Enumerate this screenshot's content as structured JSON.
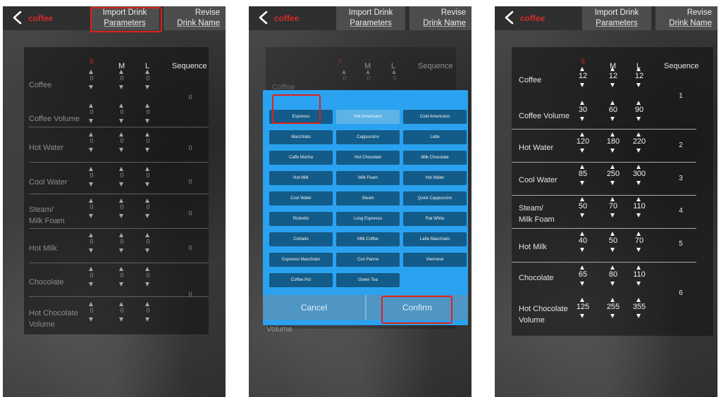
{
  "app_title": "coffee",
  "top_buttons": {
    "import": [
      "Import Drink",
      "Parameters"
    ],
    "revise": [
      "Revise",
      "Drink Name"
    ]
  },
  "headers": {
    "s": "S",
    "m": "M",
    "l": "L",
    "sequence": "Sequence"
  },
  "rows": [
    {
      "label": [
        "Coffee"
      ]
    },
    {
      "label": [
        "Coffee Volume"
      ]
    },
    {
      "label": [
        "Hot Water"
      ]
    },
    {
      "label": [
        "Cool Water"
      ]
    },
    {
      "label": [
        "Steam/",
        "Milk Foam"
      ]
    },
    {
      "label": [
        "Hot Milk"
      ]
    },
    {
      "label": [
        "Chocolate"
      ]
    },
    {
      "label": [
        "Hot Chocolate",
        "Volume"
      ]
    }
  ],
  "screen1": {
    "values": [
      [
        "0",
        "0",
        "0"
      ],
      [
        "0",
        "0",
        "0"
      ],
      [
        "0",
        "0",
        "0"
      ],
      [
        "0",
        "0",
        "0"
      ],
      [
        "0",
        "0",
        "0"
      ],
      [
        "0",
        "0",
        "0"
      ],
      [
        "0",
        "0",
        "0"
      ],
      [
        "0",
        "0",
        "0"
      ]
    ],
    "sequences": [
      "0",
      "0",
      "0",
      "0",
      "0",
      "0"
    ]
  },
  "screen3": {
    "values": [
      [
        "12",
        "12",
        "12"
      ],
      [
        "30",
        "60",
        "90"
      ],
      [
        "120",
        "180",
        "220"
      ],
      [
        "85",
        "250",
        "300"
      ],
      [
        "50",
        "70",
        "110"
      ],
      [
        "40",
        "50",
        "70"
      ],
      [
        "65",
        "80",
        "110"
      ],
      [
        "125",
        "255",
        "355"
      ]
    ],
    "sequences": [
      "1",
      "2",
      "3",
      "4",
      "5",
      "6"
    ]
  },
  "dialog": {
    "drinks": [
      "Espresso",
      "Hot Americano",
      "Cold Americano",
      "Macchiato",
      "Cappuccino",
      "Latte",
      "Caffe Mocha",
      "Hot Chocolate",
      "Milk Chocolate",
      "Hot Milk",
      "Milk Foam",
      "Hot Water",
      "Cool Water",
      "Steam",
      "Quick Cappuccino",
      "Ristretto",
      "Long Espresso",
      "Flat White",
      "Cortado",
      "Milk Coffee",
      "Latte Macchiato",
      "Espresso Macchiato",
      "Con Panna",
      "Viennese",
      "Coffee Pot",
      "Green Tea"
    ],
    "selected": "Hot Americano",
    "cancel_label": "Cancel",
    "confirm_label": "Confirm"
  },
  "colors": {
    "accent_red": "#d42a2a",
    "highlight_box": "#e0211b",
    "dialog_blue": "#2aa2f0",
    "button_dark": "#135b88"
  },
  "icons": {
    "back": "chevron-left-icon",
    "increment": "arrow-up-icon",
    "decrement": "arrow-down-icon"
  }
}
